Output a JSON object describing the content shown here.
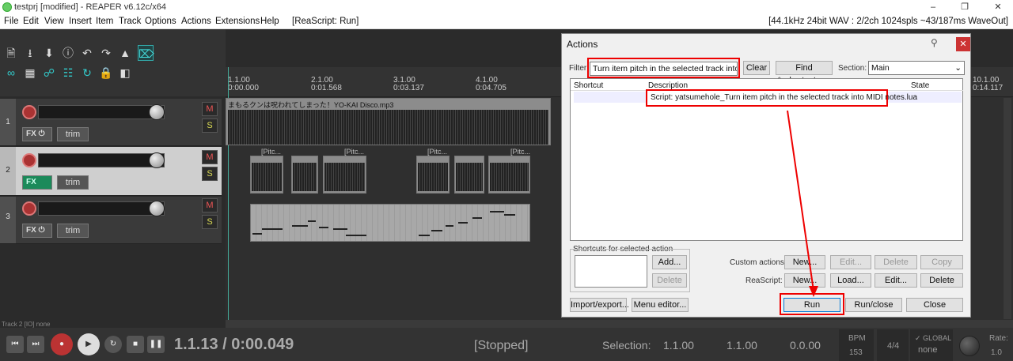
{
  "window": {
    "title": "testprj [modified] - REAPER v6.12c/x64",
    "controls": [
      "–",
      "❐",
      "✕"
    ]
  },
  "menu": {
    "items": [
      "File",
      "Edit",
      "View",
      "Insert",
      "Item",
      "Track",
      "Options",
      "Actions",
      "Extensions",
      "Help"
    ],
    "rearscript": "[ReaScript: Run]",
    "audio_info": "[44.1kHz 24bit WAV : 2/2ch 1024spls ~43/187ms WaveOut]"
  },
  "tracks": [
    {
      "number": "1",
      "fx_label": "FX",
      "trim_label": "trim",
      "m": "M",
      "s": "S"
    },
    {
      "number": "2",
      "fx_label": "FX",
      "trim_label": "trim",
      "m": "M",
      "s": "S"
    },
    {
      "number": "3",
      "fx_label": "FX",
      "trim_label": "trim",
      "m": "M",
      "s": "S"
    }
  ],
  "ruler": {
    "marks": [
      {
        "bar": "1.1.00",
        "time": "0:00.000"
      },
      {
        "bar": "2.1.00",
        "time": "0:01.568"
      },
      {
        "bar": "3.1.00",
        "time": "0:03.137"
      },
      {
        "bar": "4.1.00",
        "time": "0:04.705"
      },
      {
        "bar": "10.1.00",
        "time": "0:14.117"
      }
    ]
  },
  "items": {
    "audio_name": "まもるクンは呪われてしまった！YO-KAI Disco.mp3",
    "pitch_label": "[Pitc..."
  },
  "status_left": "Track 2 [IO] none",
  "actions_dialog": {
    "title": "Actions",
    "filter_label": "Filter:",
    "filter_value": "Turn item pitch in the selected track into MIDI n",
    "clear": "Clear",
    "find_shortcut": "Find shortcut...",
    "section_label": "Section:",
    "section_value": "Main",
    "col_shortcut": "Shortcut",
    "col_description": "Description",
    "col_state": "State",
    "row_description": "Script: yatsumehole_Turn item pitch in the selected track into MIDI notes.lua",
    "shortcuts_group": "Shortcuts for selected action",
    "add": "Add...",
    "delete": "Delete",
    "custom_actions_label": "Custom actions:",
    "reascript_label": "ReaScript:",
    "new": "New...",
    "edit": "Edit...",
    "copy": "Copy",
    "load": "Load...",
    "import_export": "Import/export...",
    "menu_editor": "Menu editor...",
    "run": "Run",
    "run_close": "Run/close",
    "close": "Close"
  },
  "transport": {
    "position": "1.1.13 / 0:00.049",
    "state": "[Stopped]",
    "selection_label": "Selection:",
    "sel_start": "1.1.00",
    "sel_end": "1.1.00",
    "sel_len": "0.0.00",
    "bpm_label": "BPM",
    "bpm": "153",
    "time_sig": "4/4",
    "global_label": "GLOBAL",
    "global_value": "none",
    "rate_label": "Rate:",
    "rate_value": "1.0"
  },
  "colors": {
    "accent_red": "#e00000",
    "record_red": "#aa3333",
    "teal": "#33cccc"
  }
}
